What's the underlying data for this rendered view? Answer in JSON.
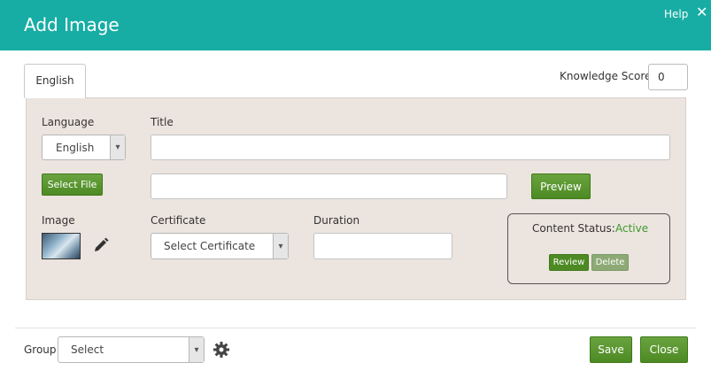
{
  "dialog": {
    "title": "Add Image",
    "help": "Help",
    "close_symbol": "✕"
  },
  "tabs": [
    {
      "label": "English"
    }
  ],
  "knowledge_score": {
    "label": "Knowledge Score",
    "value": "0"
  },
  "form": {
    "language_label": "Language",
    "language_value": "English",
    "title_label": "Title",
    "title_value": "",
    "select_file_label": "Select File",
    "file_value": "",
    "preview_label": "Preview",
    "image_label": "Image",
    "certificate_label": "Certificate",
    "certificate_value": "Select Certificate",
    "duration_label": "Duration",
    "duration_value": "",
    "content_status_label": "Content Status:",
    "content_status_value": "Active",
    "review_label": "Review",
    "delete_label": "Delete"
  },
  "footer": {
    "group_label": "Group",
    "group_value": "Select",
    "save_label": "Save",
    "close_label": "Close"
  },
  "colors": {
    "header": "#17ada4",
    "accent_green": "#4d8a24",
    "panel": "#ece4df",
    "status_active": "#3d9a2a"
  }
}
